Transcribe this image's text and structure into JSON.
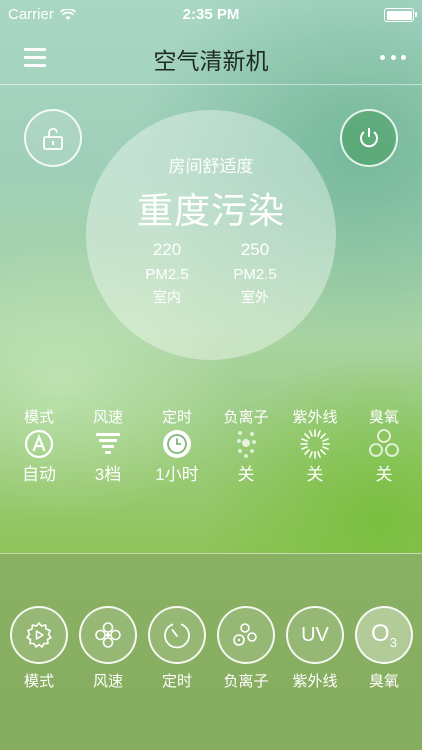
{
  "status_bar": {
    "carrier": "Carrier",
    "time": "2:35 PM"
  },
  "nav": {
    "title": "空气清新机"
  },
  "comfort": {
    "label": "房间舒适度",
    "status": "重度污染",
    "indoor": {
      "value": "220",
      "unit": "PM2.5",
      "location": "室内"
    },
    "outdoor": {
      "value": "250",
      "unit": "PM2.5",
      "location": "室外"
    }
  },
  "status_items": [
    {
      "label": "模式",
      "value": "自动",
      "icon": "auto-mode-icon"
    },
    {
      "label": "风速",
      "value": "3档",
      "icon": "fan-speed-icon"
    },
    {
      "label": "定时",
      "value": "1小时",
      "icon": "clock-icon"
    },
    {
      "label": "负离子",
      "value": "关",
      "icon": "anion-icon"
    },
    {
      "label": "紫外线",
      "value": "关",
      "icon": "uv-icon"
    },
    {
      "label": "臭氧",
      "value": "关",
      "icon": "ozone-icon"
    }
  ],
  "controls": [
    {
      "label": "模式",
      "icon": "mode-gear-icon"
    },
    {
      "label": "风速",
      "icon": "fan-icon"
    },
    {
      "label": "定时",
      "icon": "timer-icon"
    },
    {
      "label": "负离子",
      "icon": "anion-icon"
    },
    {
      "label": "紫外线",
      "icon": "uv-text-icon",
      "text": "UV"
    },
    {
      "label": "臭氧",
      "icon": "ozone-text-icon",
      "text": "O",
      "sub": "3"
    }
  ],
  "colors": {
    "bottom_panel": "#8ab064",
    "title_text": "#1f2a24",
    "power_bg": "#3c9650"
  }
}
